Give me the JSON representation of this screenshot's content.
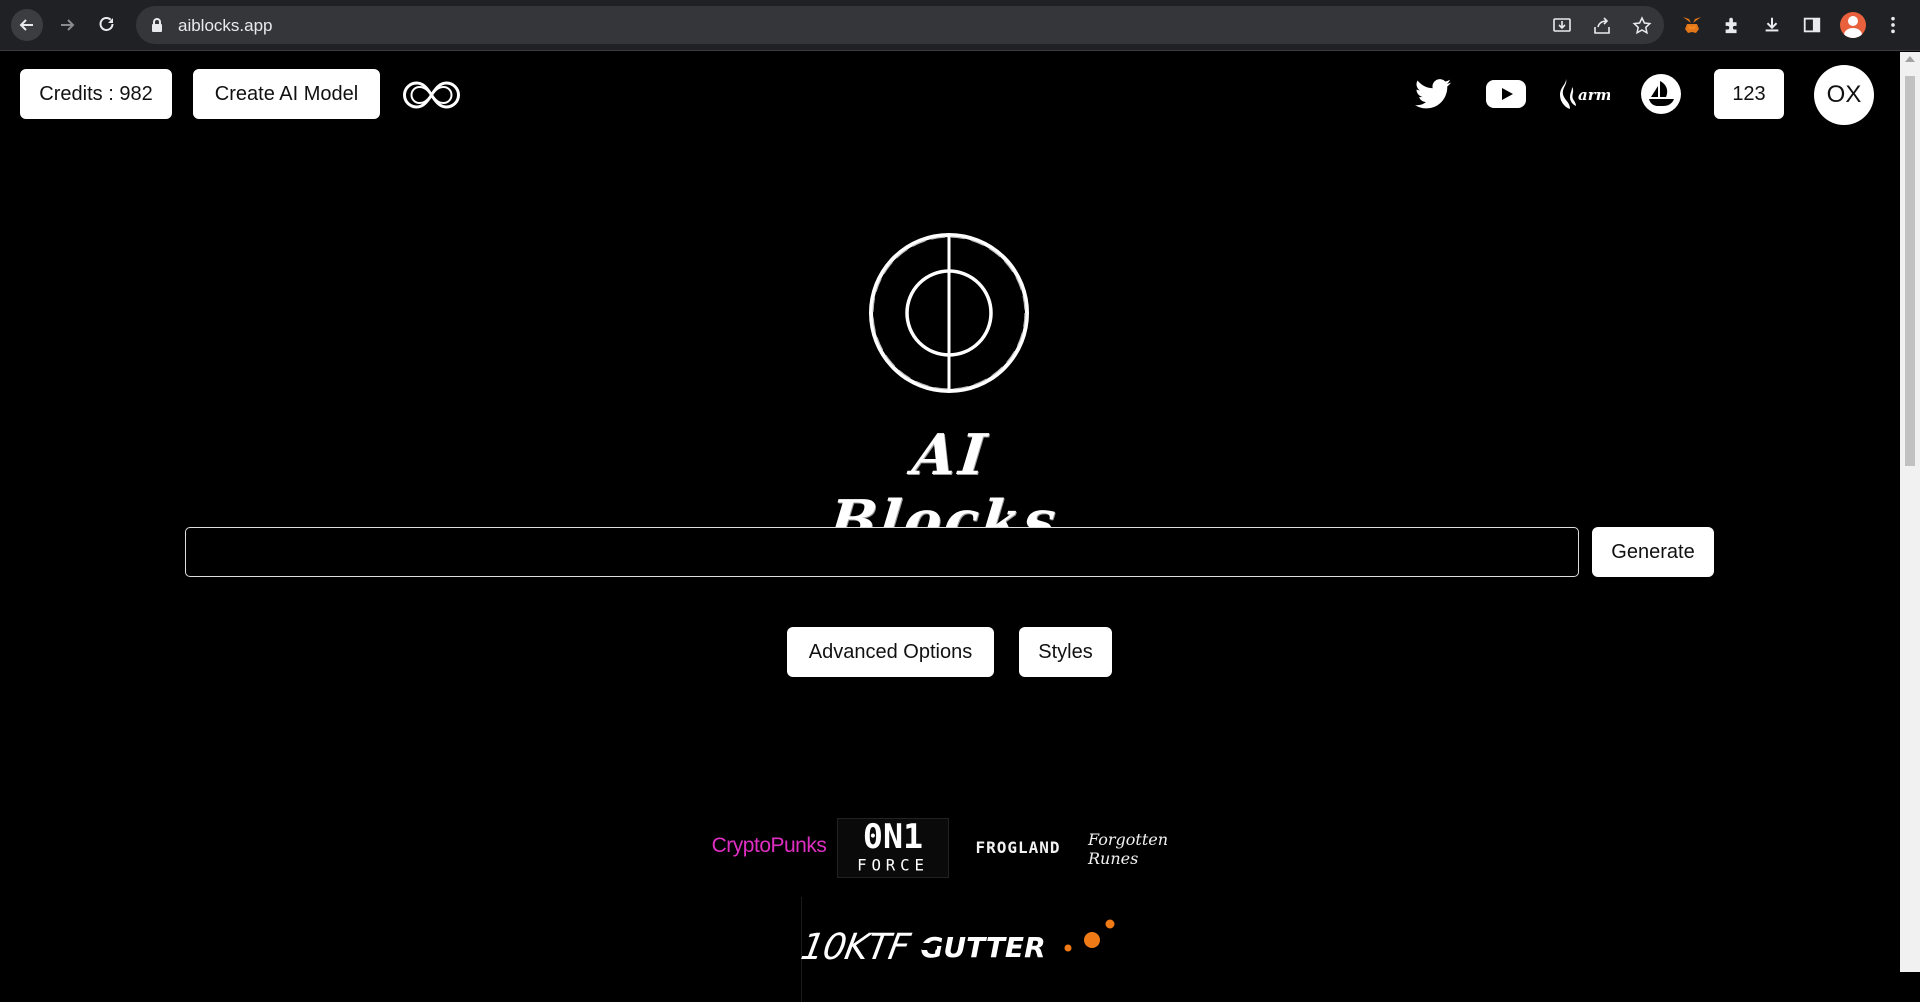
{
  "browser": {
    "url": "aiblocks.app",
    "icons": [
      "back-icon",
      "forward-icon",
      "reload-icon",
      "lock-icon",
      "install-icon",
      "share-icon",
      "bookmark-star-icon",
      "metamask-icon",
      "extensions-icon",
      "downloads-icon",
      "side-panel-icon",
      "profile-avatar-icon",
      "more-icon"
    ]
  },
  "header": {
    "credits_label": "Credits : 982",
    "create_model_label": "Create AI Model",
    "social_icons": [
      "infinity-icon",
      "twitter-icon",
      "youtube-icon",
      "warm-icon",
      "opensea-icon"
    ],
    "counter_label": "123",
    "account_label": "OX"
  },
  "hero": {
    "brand_title": "AI Blocks"
  },
  "prompt": {
    "value": "",
    "placeholder": "",
    "generate_label": "Generate"
  },
  "options": {
    "advanced_label": "Advanced Options",
    "styles_label": "Styles"
  },
  "partners": {
    "row1": [
      "CryptoPunks",
      "0N1 FORCE",
      "FROGLAND",
      "Forgotten Runes"
    ],
    "row2": [
      "10KTF",
      "GUTTER"
    ]
  },
  "colors": {
    "background": "#000000",
    "button_bg": "#ffffff",
    "cryptopunks": "#e02ec3",
    "dots_accent": "#f07b16"
  }
}
